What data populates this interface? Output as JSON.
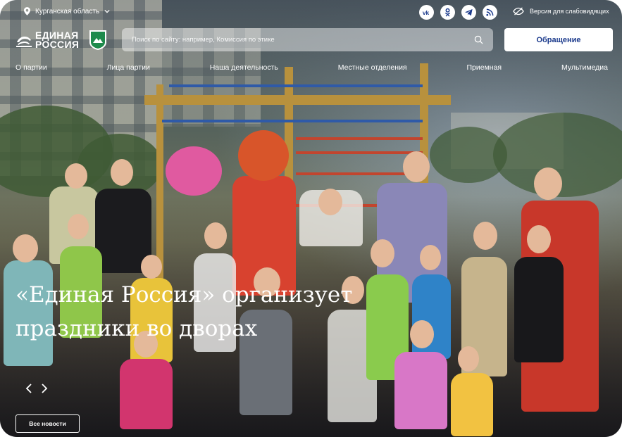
{
  "header": {
    "region": "Курганская область",
    "impaired_version": "Версия для слабовидящих",
    "logo_line1": "ЕДИНАЯ",
    "logo_line2": "РОССИЯ",
    "search_placeholder": "Поиск по сайту: например, Комиссия по этике",
    "appeal_button": "Обращение",
    "socials": [
      "vk-icon",
      "odnoklassniki-icon",
      "telegram-icon",
      "rss-icon"
    ]
  },
  "nav": {
    "items": [
      "О партии",
      "Лица партии",
      "Наша деятельность",
      "Местные отделения",
      "Приемная",
      "Мультимедиа"
    ]
  },
  "slide": {
    "headline_line1": "«Единая Россия» организует",
    "headline_line2": "праздники во дворах",
    "all_news": "Все новости"
  },
  "colors": {
    "accent": "#1b3a8c",
    "overlay": "#141e2d",
    "emblem_green": "#1e8a4c"
  }
}
